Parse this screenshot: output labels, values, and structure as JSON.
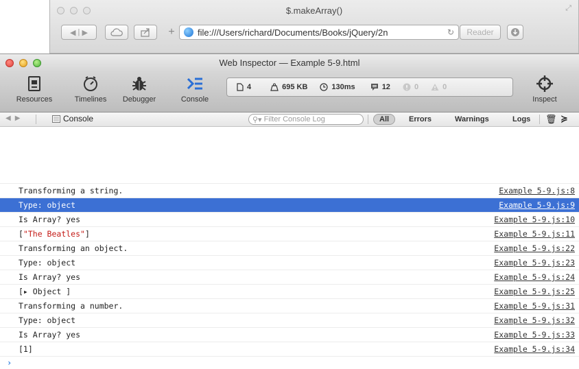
{
  "safari": {
    "title": "$.makeArray()",
    "address": "file:///Users/richard/Documents/Books/jQuery/2n",
    "reader_label": "Reader"
  },
  "inspector": {
    "title": "Web Inspector — Example 5-9.html",
    "toolbar": {
      "resources": "Resources",
      "timelines": "Timelines",
      "debugger": "Debugger",
      "console": "Console",
      "inspect": "Inspect"
    },
    "dashboard": {
      "resources_count": "4",
      "size": "695 KB",
      "time": "130ms",
      "logs_count": "12",
      "errors_count": "0",
      "warnings_count": "0"
    },
    "console_bar": {
      "breadcrumb": "Console",
      "filter_placeholder": "Filter Console Log",
      "scopes": [
        "All",
        "Errors",
        "Warnings",
        "Logs"
      ]
    }
  },
  "colors": {
    "selection": "#3c70d4",
    "string_literal": "#c41a16",
    "prompt": "#2f7fe0"
  },
  "messages": [
    {
      "text": "Transforming a string.",
      "source": "Example 5-9.js:8"
    },
    {
      "text": "Type: object",
      "source": "Example 5-9.js:9",
      "selected": true
    },
    {
      "text": "Is Array? yes",
      "source": "Example 5-9.js:10"
    },
    {
      "prefix": "[",
      "string": "\"The Beatles\"",
      "suffix": "]",
      "source": "Example 5-9.js:11"
    },
    {
      "text": "Transforming an object.",
      "source": "Example 5-9.js:22"
    },
    {
      "text": "Type: object",
      "source": "Example 5-9.js:23"
    },
    {
      "text": "Is Array? yes",
      "source": "Example 5-9.js:24"
    },
    {
      "text": "[▸ Object ]",
      "source": "Example 5-9.js:25"
    },
    {
      "text": "Transforming a number.",
      "source": "Example 5-9.js:31"
    },
    {
      "text": "Type: object",
      "source": "Example 5-9.js:32"
    },
    {
      "text": "Is Array? yes",
      "source": "Example 5-9.js:33"
    },
    {
      "text": "[1]",
      "source": "Example 5-9.js:34"
    }
  ],
  "prompt_symbol": "›"
}
